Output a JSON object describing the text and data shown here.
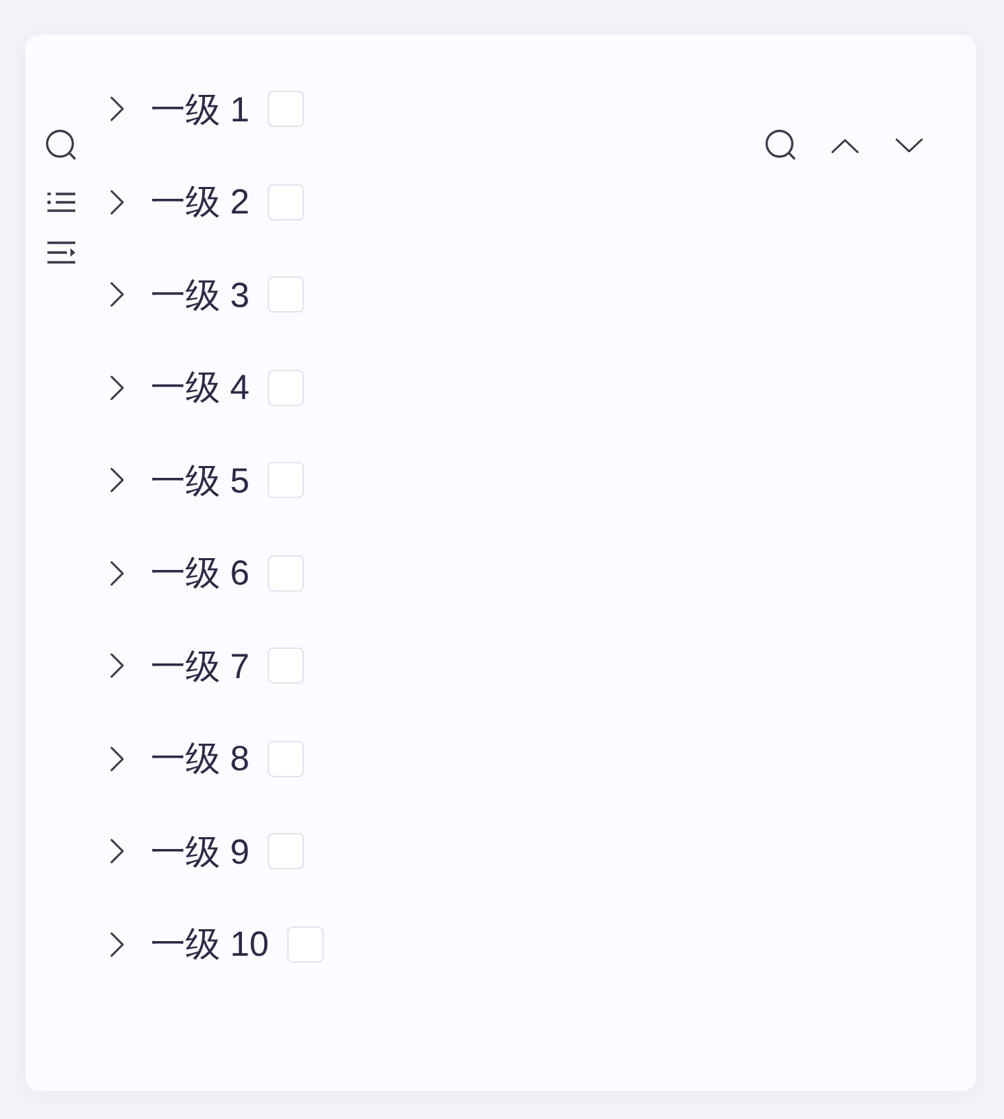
{
  "tree": {
    "items": [
      {
        "label": "一级 1",
        "expanded": false,
        "checked": false
      },
      {
        "label": "一级 2",
        "expanded": false,
        "checked": false
      },
      {
        "label": "一级 3",
        "expanded": false,
        "checked": false
      },
      {
        "label": "一级 4",
        "expanded": false,
        "checked": false
      },
      {
        "label": "一级 5",
        "expanded": false,
        "checked": false
      },
      {
        "label": "一级 6",
        "expanded": false,
        "checked": false
      },
      {
        "label": "一级 7",
        "expanded": false,
        "checked": false
      },
      {
        "label": "一级 8",
        "expanded": false,
        "checked": false
      },
      {
        "label": "一级 9",
        "expanded": false,
        "checked": false
      },
      {
        "label": "一级 10",
        "expanded": false,
        "checked": false
      }
    ]
  }
}
